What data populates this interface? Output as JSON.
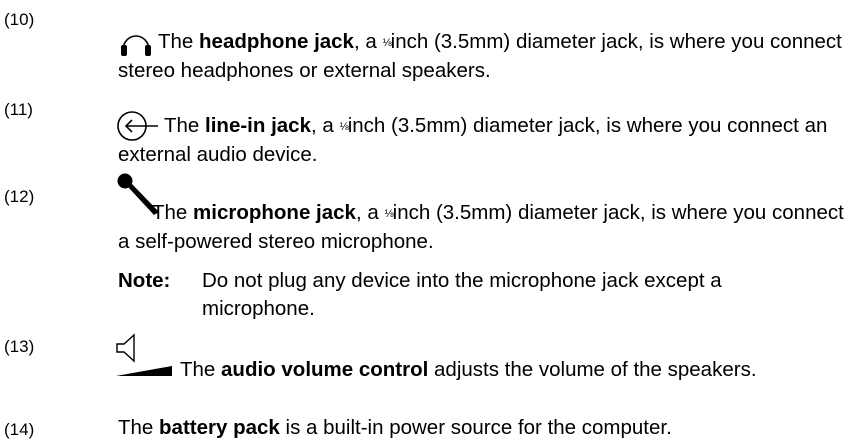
{
  "items": [
    {
      "number": "(10)",
      "icon": "headphone-icon",
      "pre": "The ",
      "term": "headphone jack",
      "mid": ", a ",
      "frac": "⅛",
      "post": "inch (3.5mm) diameter jack, is where you connect stereo headphones or external speakers."
    },
    {
      "number": "(11)",
      "icon": "line-in-icon",
      "pre": "The ",
      "term": "line-in jack",
      "mid": ", a ",
      "frac": "⅛",
      "post": "inch (3.5mm) diameter jack, is where you connect an external audio device."
    },
    {
      "number": "(12)",
      "icon": "microphone-icon",
      "pre": "The ",
      "term": "microphone jack",
      "mid": ", a ",
      "frac": "⅛",
      "post": "inch (3.5mm) diameter jack, is where you connect a self-powered stereo microphone."
    },
    {
      "number": "(13)",
      "icon": "volume-icon",
      "pre": "The ",
      "term": "audio volume control",
      "post": " adjusts the volume of the speakers."
    },
    {
      "number": "(14)",
      "pre": "The ",
      "term": "battery pack",
      "post": " is a built-in power source for the computer."
    }
  ],
  "note": {
    "label": "Note:",
    "text": "Do not plug any device into the microphone jack except a microphone."
  }
}
